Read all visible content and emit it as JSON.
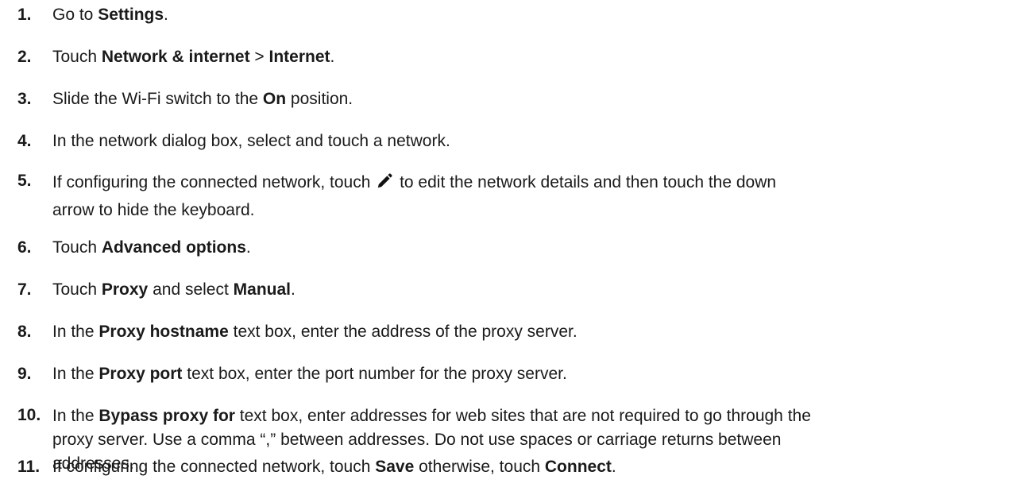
{
  "steps": [
    {
      "number": "1.",
      "parts": [
        {
          "text": "Go to "
        },
        {
          "text": "Settings",
          "bold": true
        },
        {
          "text": "."
        }
      ]
    },
    {
      "number": "2.",
      "parts": [
        {
          "text": "Touch "
        },
        {
          "text": "Network & internet",
          "bold": true
        },
        {
          "text": " > "
        },
        {
          "text": "Internet",
          "bold": true
        },
        {
          "text": "."
        }
      ]
    },
    {
      "number": "3.",
      "parts": [
        {
          "text": "Slide the Wi-Fi switch to the "
        },
        {
          "text": "On",
          "bold": true
        },
        {
          "text": " position."
        }
      ]
    },
    {
      "number": "4.",
      "parts": [
        {
          "text": "In the network dialog box, select and touch a network."
        }
      ]
    },
    {
      "number": "5.",
      "parts": [
        {
          "text": "If configuring the connected network, touch "
        },
        {
          "icon": "pencil-icon"
        },
        {
          "text": " to edit the network details and then touch the down"
        },
        {
          "break": true
        },
        {
          "text": "arrow to hide the keyboard."
        }
      ]
    },
    {
      "number": "6.",
      "parts": [
        {
          "text": "Touch "
        },
        {
          "text": "Advanced options",
          "bold": true
        },
        {
          "text": "."
        }
      ]
    },
    {
      "number": "7.",
      "parts": [
        {
          "text": "Touch "
        },
        {
          "text": "Proxy",
          "bold": true
        },
        {
          "text": " and select "
        },
        {
          "text": "Manual",
          "bold": true
        },
        {
          "text": "."
        }
      ]
    },
    {
      "number": "8.",
      "parts": [
        {
          "text": "In the "
        },
        {
          "text": "Proxy hostname",
          "bold": true
        },
        {
          "text": " text box, enter the address of the proxy server."
        }
      ]
    },
    {
      "number": "9.",
      "parts": [
        {
          "text": "In the "
        },
        {
          "text": "Proxy port",
          "bold": true
        },
        {
          "text": " text box, enter the port number for the proxy server."
        }
      ]
    },
    {
      "number": "10.",
      "parts": [
        {
          "text": "In the "
        },
        {
          "text": "Bypass proxy for",
          "bold": true
        },
        {
          "text": " text box, enter addresses for web sites that are not required to go through the"
        },
        {
          "break": true
        },
        {
          "text": "proxy server. Use a comma “,” between addresses. Do not use spaces or carriage returns between"
        },
        {
          "break": true
        },
        {
          "text": "addresses."
        }
      ]
    },
    {
      "number": "11.",
      "parts": [
        {
          "text": "If configuring the connected network, touch "
        },
        {
          "text": "Save",
          "bold": true
        },
        {
          "text": " otherwise, touch "
        },
        {
          "text": "Connect",
          "bold": true
        },
        {
          "text": "."
        }
      ]
    }
  ]
}
